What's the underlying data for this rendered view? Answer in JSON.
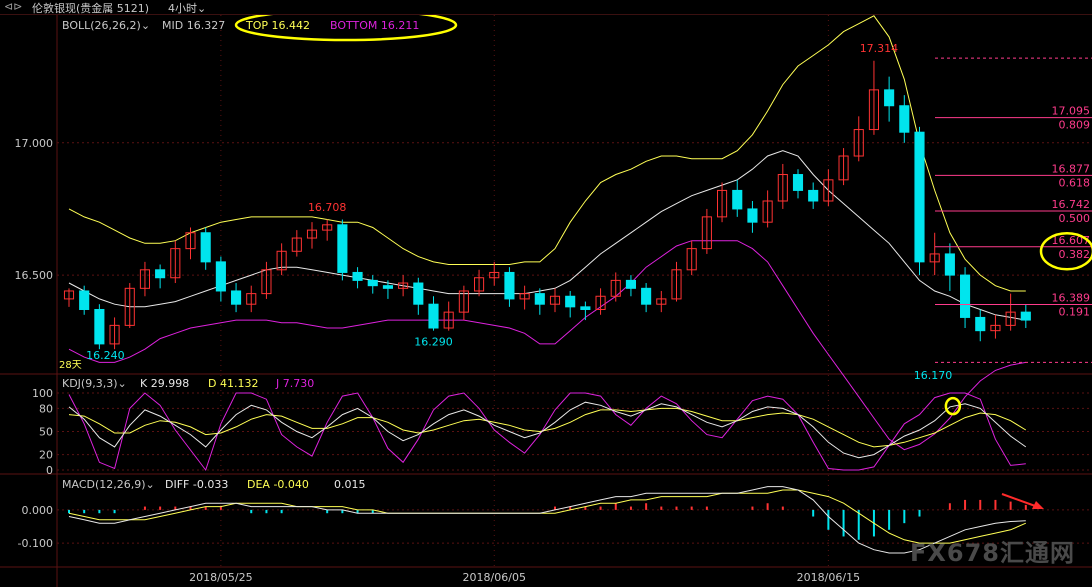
{
  "window": {
    "nav_icon": "back-forward-icon",
    "title": "伦敦银现(贵金属 5121)",
    "period": "4小时",
    "period_caret": "chevron-down-icon"
  },
  "colors": {
    "bg": "#000000",
    "grid": "#5a1212",
    "up": "#ff3333",
    "down": "#00e5ee",
    "yellow": "#ffff55",
    "white": "#e8e8e8",
    "magenta": "#dd22dd",
    "axis_text": "#c8c8c8",
    "fib": "#ff3c8c",
    "annot": "#ffff00",
    "arrow": "#ff2a2a"
  },
  "boll_header": {
    "name": "BOLL(26,26,2)",
    "mid": "MID 16.327",
    "top": "TOP 16.442",
    "bottom": "BOTTOM 16.211"
  },
  "kdj_header": {
    "name": "KDJ(9,3,3)",
    "k": "K 29.998",
    "d": "D 41.132",
    "j": "J 7.730"
  },
  "macd_header": {
    "name": "MACD(12,26,9)",
    "diff": "DIFF -0.033",
    "dea": "DEA -0.040",
    "macd": "0.015"
  },
  "price_axis": [
    "17.000",
    "16.500"
  ],
  "kdj_axis": [
    "100",
    "80",
    "50",
    "20",
    "0"
  ],
  "macd_axis": [
    "0.000",
    "-0.100"
  ],
  "date_labels": [
    "2018/05/25",
    "2018/06/05",
    "2018/06/15"
  ],
  "annotations": {
    "high": "17.314",
    "left_peak": "16.708",
    "left_low": "16.240",
    "mid_low": "16.290",
    "right_low": "16.170",
    "days": "28天"
  },
  "fib_levels": [
    {
      "price": "17.095",
      "ratio": "0.809"
    },
    {
      "price": "16.877",
      "ratio": "0.618"
    },
    {
      "price": "16.742",
      "ratio": "0.500"
    },
    {
      "price": "16.607",
      "ratio": "0.382"
    },
    {
      "price": "16.389",
      "ratio": "0.191"
    }
  ],
  "watermark": "FX678汇通网",
  "chart_data": {
    "type": "candlestick",
    "price_range": [
      16.13,
      17.43
    ],
    "kdj_range": [
      0,
      100
    ],
    "macd_range": [
      -0.16,
      0.09
    ],
    "boll_mid": [
      16.47,
      16.44,
      16.41,
      16.39,
      16.38,
      16.38,
      16.39,
      16.4,
      16.42,
      16.44,
      16.46,
      16.48,
      16.5,
      16.52,
      16.53,
      16.53,
      16.52,
      16.51,
      16.5,
      16.49,
      16.48,
      16.47,
      16.46,
      16.45,
      16.44,
      16.43,
      16.43,
      16.43,
      16.43,
      16.43,
      16.43,
      16.44,
      16.45,
      16.48,
      16.53,
      16.58,
      16.62,
      16.66,
      16.7,
      16.74,
      16.77,
      16.8,
      16.82,
      16.84,
      16.86,
      16.9,
      16.95,
      16.97,
      16.95,
      16.88,
      16.82,
      16.77,
      16.72,
      16.67,
      16.62,
      16.55,
      16.48,
      16.44,
      16.42,
      16.39,
      16.37,
      16.35,
      16.34,
      16.33
    ],
    "boll_top": [
      16.75,
      16.72,
      16.7,
      16.67,
      16.64,
      16.62,
      16.62,
      16.63,
      16.66,
      16.68,
      16.7,
      16.71,
      16.72,
      16.72,
      16.72,
      16.72,
      16.72,
      16.71,
      16.7,
      16.7,
      16.68,
      16.64,
      16.6,
      16.57,
      16.55,
      16.54,
      16.54,
      16.54,
      16.54,
      16.54,
      16.55,
      16.55,
      16.6,
      16.7,
      16.78,
      16.85,
      16.88,
      16.9,
      16.93,
      16.95,
      16.95,
      16.94,
      16.94,
      16.94,
      16.97,
      17.03,
      17.12,
      17.22,
      17.29,
      17.33,
      17.37,
      17.42,
      17.45,
      17.48,
      17.4,
      17.24,
      17.0,
      16.82,
      16.66,
      16.56,
      16.5,
      16.46,
      16.44,
      16.44
    ],
    "boll_bottom": [
      16.22,
      16.19,
      16.17,
      16.17,
      16.19,
      16.22,
      16.26,
      16.28,
      16.3,
      16.31,
      16.32,
      16.33,
      16.33,
      16.33,
      16.32,
      16.32,
      16.31,
      16.3,
      16.3,
      16.31,
      16.32,
      16.33,
      16.33,
      16.33,
      16.33,
      16.33,
      16.33,
      16.32,
      16.31,
      16.3,
      16.28,
      16.24,
      16.24,
      16.29,
      16.34,
      16.38,
      16.42,
      16.47,
      16.53,
      16.57,
      16.61,
      16.63,
      16.63,
      16.63,
      16.63,
      16.6,
      16.55,
      16.46,
      16.37,
      16.28,
      16.2,
      16.12,
      16.04,
      15.96,
      15.88,
      15.84,
      15.86,
      15.9,
      15.96,
      16.04,
      16.1,
      16.14,
      16.16,
      16.17
    ],
    "candles": [
      [
        16.41,
        16.44,
        16.38,
        16.45
      ],
      [
        16.44,
        16.37,
        16.35,
        16.46
      ],
      [
        16.37,
        16.24,
        16.22,
        16.39
      ],
      [
        16.24,
        16.31,
        16.22,
        16.34
      ],
      [
        16.31,
        16.45,
        16.3,
        16.47
      ],
      [
        16.45,
        16.52,
        16.42,
        16.55
      ],
      [
        16.52,
        16.49,
        16.45,
        16.54
      ],
      [
        16.49,
        16.6,
        16.47,
        16.63
      ],
      [
        16.6,
        16.66,
        16.56,
        16.68
      ],
      [
        16.66,
        16.55,
        16.52,
        16.68
      ],
      [
        16.55,
        16.44,
        16.4,
        16.57
      ],
      [
        16.44,
        16.39,
        16.36,
        16.47
      ],
      [
        16.39,
        16.43,
        16.36,
        16.46
      ],
      [
        16.43,
        16.52,
        16.41,
        16.55
      ],
      [
        16.52,
        16.59,
        16.5,
        16.62
      ],
      [
        16.59,
        16.64,
        16.57,
        16.67
      ],
      [
        16.64,
        16.67,
        16.6,
        16.7
      ],
      [
        16.67,
        16.69,
        16.63,
        16.71
      ],
      [
        16.69,
        16.51,
        16.48,
        16.71
      ],
      [
        16.51,
        16.48,
        16.45,
        16.53
      ],
      [
        16.48,
        16.46,
        16.43,
        16.5
      ],
      [
        16.46,
        16.45,
        16.41,
        16.48
      ],
      [
        16.45,
        16.47,
        16.42,
        16.5
      ],
      [
        16.47,
        16.39,
        16.35,
        16.49
      ],
      [
        16.39,
        16.3,
        16.29,
        16.42
      ],
      [
        16.3,
        16.36,
        16.29,
        16.4
      ],
      [
        16.36,
        16.44,
        16.33,
        16.46
      ],
      [
        16.44,
        16.49,
        16.42,
        16.52
      ],
      [
        16.49,
        16.51,
        16.46,
        16.55
      ],
      [
        16.51,
        16.41,
        16.38,
        16.53
      ],
      [
        16.41,
        16.43,
        16.37,
        16.46
      ],
      [
        16.43,
        16.39,
        16.35,
        16.45
      ],
      [
        16.39,
        16.42,
        16.36,
        16.45
      ],
      [
        16.42,
        16.38,
        16.34,
        16.44
      ],
      [
        16.38,
        16.37,
        16.33,
        16.4
      ],
      [
        16.37,
        16.42,
        16.35,
        16.45
      ],
      [
        16.42,
        16.48,
        16.4,
        16.51
      ],
      [
        16.48,
        16.45,
        16.42,
        16.5
      ],
      [
        16.45,
        16.39,
        16.36,
        16.47
      ],
      [
        16.39,
        16.41,
        16.36,
        16.44
      ],
      [
        16.41,
        16.52,
        16.4,
        16.55
      ],
      [
        16.52,
        16.6,
        16.5,
        16.63
      ],
      [
        16.6,
        16.72,
        16.58,
        16.75
      ],
      [
        16.72,
        16.82,
        16.7,
        16.85
      ],
      [
        16.82,
        16.75,
        16.72,
        16.86
      ],
      [
        16.75,
        16.7,
        16.66,
        16.78
      ],
      [
        16.7,
        16.78,
        16.68,
        16.82
      ],
      [
        16.78,
        16.88,
        16.75,
        16.92
      ],
      [
        16.88,
        16.82,
        16.79,
        16.9
      ],
      [
        16.82,
        16.78,
        16.75,
        16.85
      ],
      [
        16.78,
        16.86,
        16.76,
        16.9
      ],
      [
        16.86,
        16.95,
        16.84,
        16.98
      ],
      [
        16.95,
        17.05,
        16.93,
        17.1
      ],
      [
        17.05,
        17.2,
        17.03,
        17.31
      ],
      [
        17.2,
        17.14,
        17.08,
        17.25
      ],
      [
        17.14,
        17.04,
        17.0,
        17.18
      ],
      [
        17.04,
        16.55,
        16.5,
        17.06
      ],
      [
        16.55,
        16.58,
        16.5,
        16.66
      ],
      [
        16.58,
        16.5,
        16.44,
        16.62
      ],
      [
        16.5,
        16.34,
        16.3,
        16.53
      ],
      [
        16.34,
        16.29,
        16.25,
        16.37
      ],
      [
        16.29,
        16.31,
        16.26,
        16.35
      ],
      [
        16.31,
        16.36,
        16.29,
        16.43
      ],
      [
        16.36,
        16.33,
        16.3,
        16.39
      ]
    ],
    "kdj_k": [
      82,
      66,
      42,
      30,
      58,
      78,
      70,
      58,
      46,
      30,
      52,
      72,
      84,
      78,
      62,
      50,
      42,
      56,
      72,
      80,
      68,
      50,
      38,
      46,
      60,
      72,
      78,
      70,
      58,
      50,
      42,
      48,
      62,
      78,
      88,
      84,
      76,
      70,
      78,
      86,
      82,
      72,
      62,
      56,
      64,
      76,
      82,
      80,
      72,
      56,
      36,
      22,
      16,
      20,
      32,
      44,
      52,
      64,
      82,
      86,
      80,
      62,
      44,
      30
    ],
    "kdj_d": [
      72,
      70,
      60,
      48,
      48,
      58,
      64,
      62,
      56,
      46,
      48,
      56,
      66,
      72,
      70,
      62,
      54,
      54,
      60,
      68,
      68,
      62,
      52,
      48,
      52,
      58,
      64,
      66,
      62,
      58,
      52,
      50,
      54,
      62,
      72,
      78,
      78,
      76,
      78,
      80,
      80,
      76,
      70,
      64,
      64,
      68,
      72,
      74,
      72,
      66,
      56,
      46,
      36,
      30,
      32,
      36,
      42,
      48,
      58,
      68,
      74,
      72,
      64,
      52
    ],
    "kdj_j": [
      98,
      60,
      10,
      2,
      80,
      100,
      84,
      52,
      26,
      0,
      60,
      100,
      100,
      92,
      46,
      30,
      18,
      62,
      96,
      100,
      68,
      28,
      10,
      40,
      78,
      96,
      100,
      80,
      52,
      36,
      22,
      46,
      78,
      100,
      100,
      96,
      72,
      58,
      80,
      96,
      86,
      64,
      46,
      42,
      66,
      90,
      96,
      92,
      72,
      36,
      2,
      0,
      0,
      4,
      32,
      60,
      72,
      94,
      100,
      100,
      92,
      40,
      6,
      8
    ],
    "macd_diff": [
      -0.02,
      -0.03,
      -0.04,
      -0.04,
      -0.03,
      -0.02,
      -0.01,
      0.0,
      0.01,
      0.02,
      0.02,
      0.02,
      0.01,
      0.01,
      0.01,
      0.01,
      0.01,
      0.0,
      0.0,
      -0.01,
      -0.01,
      -0.01,
      -0.01,
      -0.01,
      -0.01,
      -0.01,
      -0.01,
      -0.01,
      -0.01,
      -0.01,
      -0.01,
      -0.01,
      0.0,
      0.01,
      0.02,
      0.03,
      0.04,
      0.04,
      0.05,
      0.05,
      0.05,
      0.05,
      0.05,
      0.05,
      0.05,
      0.06,
      0.07,
      0.07,
      0.06,
      0.03,
      -0.02,
      -0.06,
      -0.1,
      -0.12,
      -0.13,
      -0.13,
      -0.12,
      -0.1,
      -0.08,
      -0.06,
      -0.05,
      -0.04,
      -0.035,
      -0.033
    ],
    "macd_dea": [
      -0.01,
      -0.02,
      -0.03,
      -0.03,
      -0.03,
      -0.03,
      -0.02,
      -0.01,
      0.0,
      0.01,
      0.01,
      0.02,
      0.02,
      0.02,
      0.02,
      0.01,
      0.01,
      0.01,
      0.01,
      0.0,
      0.0,
      -0.01,
      -0.01,
      -0.01,
      -0.01,
      -0.01,
      -0.01,
      -0.01,
      -0.01,
      -0.01,
      -0.01,
      -0.01,
      -0.01,
      0.0,
      0.01,
      0.02,
      0.02,
      0.03,
      0.03,
      0.04,
      0.04,
      0.04,
      0.04,
      0.05,
      0.05,
      0.05,
      0.05,
      0.06,
      0.06,
      0.05,
      0.04,
      0.02,
      -0.01,
      -0.04,
      -0.07,
      -0.09,
      -0.1,
      -0.1,
      -0.1,
      -0.09,
      -0.08,
      -0.07,
      -0.06,
      -0.04
    ],
    "macd_hist": [
      -0.01,
      -0.01,
      -0.01,
      -0.01,
      0.0,
      0.01,
      0.01,
      0.01,
      0.01,
      0.01,
      0.01,
      0.0,
      -0.01,
      -0.01,
      -0.01,
      0.0,
      0.0,
      -0.01,
      -0.01,
      -0.01,
      -0.01,
      0.0,
      0.0,
      0.0,
      0.0,
      0.0,
      0.0,
      0.0,
      0.0,
      0.0,
      0.0,
      0.0,
      0.01,
      0.01,
      0.01,
      0.01,
      0.02,
      0.01,
      0.02,
      0.01,
      0.01,
      0.01,
      0.01,
      0.0,
      0.0,
      0.01,
      0.02,
      0.01,
      0.0,
      -0.02,
      -0.06,
      -0.08,
      -0.09,
      -0.08,
      -0.06,
      -0.04,
      -0.02,
      0.0,
      0.02,
      0.03,
      0.03,
      0.03,
      0.025,
      0.015
    ]
  }
}
